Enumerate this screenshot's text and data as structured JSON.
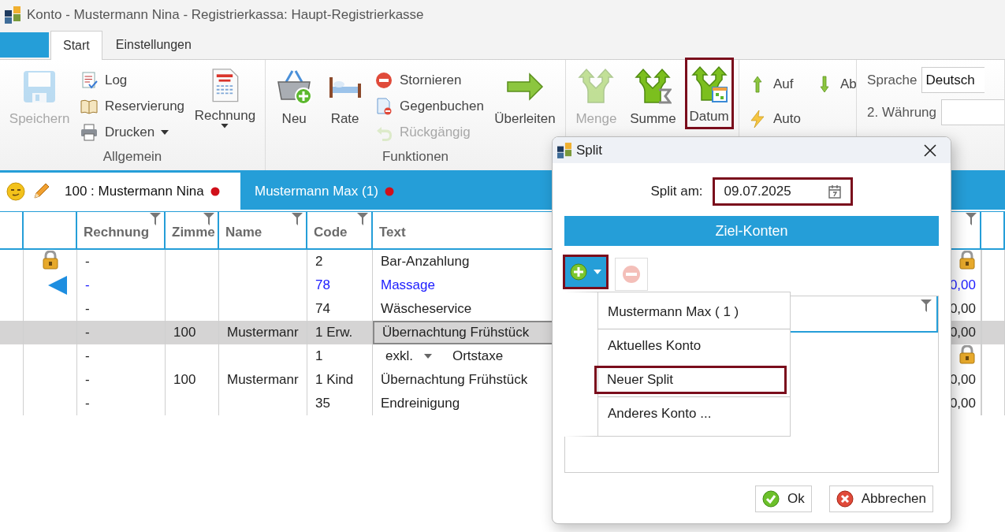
{
  "window": {
    "title": "Konto - Mustermann Nina - Registrierkassa: Haupt-Registrierkasse"
  },
  "ribbon_tabs": [
    {
      "label": "Start",
      "selected": true
    },
    {
      "label": "Einstellungen",
      "selected": false
    }
  ],
  "ribbon_groups": [
    {
      "label": "Allgemein",
      "columns": [
        [
          {
            "kind": "large",
            "label": "Speichern",
            "disabled": true,
            "dropdown": false,
            "highlighted": false
          }
        ],
        [
          {
            "kind": "small",
            "label": "Log",
            "disabled": false,
            "dropdown": false,
            "highlighted": false
          },
          {
            "kind": "small",
            "label": "Reservierung",
            "disabled": false,
            "dropdown": false,
            "highlighted": false
          },
          {
            "kind": "small",
            "label": "Drucken",
            "disabled": false,
            "dropdown": true,
            "highlighted": false
          }
        ],
        [
          {
            "kind": "large",
            "label": "Rechnung",
            "disabled": false,
            "dropdown": true,
            "highlighted": false
          }
        ]
      ]
    },
    {
      "label": "Funktionen",
      "columns": [
        [
          {
            "kind": "large",
            "label": "Neu",
            "disabled": false,
            "dropdown": false,
            "highlighted": false
          }
        ],
        [
          {
            "kind": "large",
            "label": "Rate",
            "disabled": false,
            "dropdown": false,
            "highlighted": false
          }
        ],
        [
          {
            "kind": "small",
            "label": "Stornieren",
            "disabled": false,
            "dropdown": false,
            "highlighted": false
          },
          {
            "kind": "small",
            "label": "Gegenbuchen",
            "disabled": false,
            "dropdown": false,
            "highlighted": false
          },
          {
            "kind": "small",
            "label": "Rückgängig",
            "disabled": true,
            "dropdown": false,
            "highlighted": false
          }
        ],
        [
          {
            "kind": "large",
            "label": "Überleiten",
            "disabled": false,
            "dropdown": false,
            "highlighted": false
          }
        ]
      ]
    },
    {
      "columns": [
        [
          {
            "kind": "large",
            "label": "Menge",
            "disabled": true,
            "dropdown": false,
            "highlighted": false
          }
        ],
        [
          {
            "kind": "large",
            "label": "Summe",
            "disabled": false,
            "dropdown": false,
            "highlighted": false
          }
        ],
        [
          {
            "kind": "large",
            "label": "Datum",
            "disabled": false,
            "dropdown": false,
            "highlighted": true
          }
        ]
      ]
    },
    {
      "columns": [
        [
          {
            "kind": "small",
            "label": "Auf",
            "disabled": false,
            "dropdown": false,
            "highlighted": false
          },
          {
            "kind": "small",
            "label": "Auto",
            "disabled": false,
            "dropdown": false,
            "highlighted": false
          }
        ],
        [
          {
            "kind": "small",
            "label": "Ab",
            "disabled": false,
            "dropdown": false,
            "highlighted": false
          }
        ]
      ]
    },
    {
      "columns": [
        [
          {
            "kind": "field",
            "label": "Sprache",
            "value": "Deutsch"
          },
          {
            "kind": "field",
            "label": "2. Währung"
          }
        ]
      ]
    }
  ],
  "account_tabs": [
    {
      "label": "100 :  Mustermann Nina",
      "selected": true
    },
    {
      "label": "Mustermann Max (1)",
      "selected": false
    }
  ],
  "table": {
    "columns": [
      {
        "label": "Rechnung",
        "filter": true
      },
      {
        "label": "Zimme",
        "filter": true
      },
      {
        "label": "Name",
        "filter": true
      },
      {
        "label": "Code",
        "filter": true
      },
      {
        "label": "Text"
      },
      {
        "filter": true
      }
    ],
    "rows": [
      {
        "rechnung": "-",
        "code": "2",
        "text": "Bar-Anzahlung",
        "locked": true,
        "current": false,
        "emphasized": false,
        "selected": false,
        "amount_locked": true
      },
      {
        "rechnung": "-",
        "code": "78",
        "text": "Massage",
        "locked": false,
        "current": true,
        "emphasized": true,
        "selected": false,
        "amount_locked": false,
        "amount": "0,00"
      },
      {
        "rechnung": "-",
        "code": "74",
        "text": "Wäscheservice",
        "locked": false,
        "current": false,
        "emphasized": false,
        "selected": false,
        "amount_locked": false,
        "amount": "0,00"
      },
      {
        "rechnung": "-",
        "zimmer": "100",
        "name": "Mustermanr",
        "code": "1 Erw.",
        "text": "Übernachtung Frühstück",
        "locked": false,
        "current": false,
        "emphasized": false,
        "selected": true,
        "amount_locked": false,
        "amount": "0,00"
      },
      {
        "kind": "tax",
        "rechnung": "-",
        "code": "1",
        "tax_mode": "exkl.",
        "text": "Ortstaxe",
        "locked": false,
        "current": false,
        "emphasized": false,
        "selected": false,
        "amount_locked": true
      },
      {
        "rechnung": "-",
        "zimmer": "100",
        "name": "Mustermanr",
        "code": "1 Kind",
        "text": "Übernachtung Frühstück",
        "locked": false,
        "current": false,
        "emphasized": false,
        "selected": false,
        "amount_locked": false,
        "amount": "0,00"
      },
      {
        "rechnung": "-",
        "code": "35",
        "text": "Endreinigung",
        "locked": false,
        "current": false,
        "emphasized": false,
        "selected": false,
        "amount_locked": false,
        "amount": "0,00"
      }
    ]
  },
  "dialog": {
    "title": "Split",
    "date_label": "Split am:",
    "date_value": "09.07.2025",
    "date_highlighted": true,
    "section": "Ziel-Konten",
    "add_button": {
      "highlighted": true
    },
    "remove_button": {
      "disabled": true
    },
    "list": {
      "filter": true
    },
    "menu": [
      {
        "label": "Mustermann Max ( 1 )",
        "highlighted": false,
        "separator_after": true
      },
      {
        "label": "Aktuelles Konto",
        "highlighted": false,
        "separator_after": false
      },
      {
        "label": "Neuer Split",
        "highlighted": true,
        "separator_after": true
      },
      {
        "label": "Anderes Konto ...",
        "highlighted": false,
        "separator_after": false
      }
    ],
    "buttons": [
      {
        "kind": "ok",
        "label": "Ok"
      },
      {
        "kind": "cancel",
        "label": "Abbrechen"
      }
    ]
  }
}
